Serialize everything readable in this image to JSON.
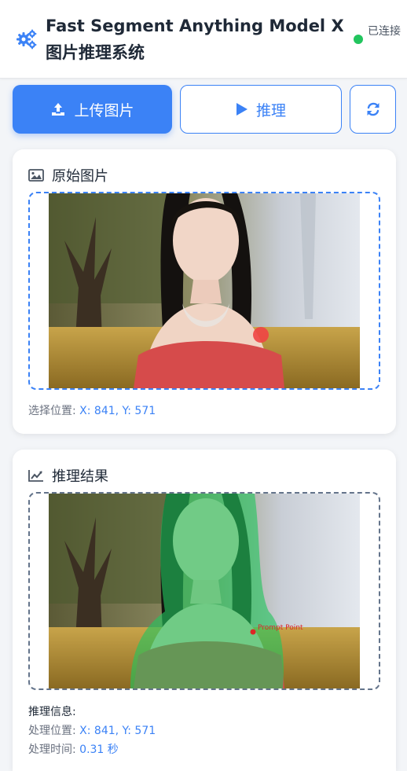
{
  "header": {
    "title": "Fast Segment Anything Model X 图片推理系统",
    "status_text": "已连接",
    "status_color": "#22c55e",
    "logo_icon": "gears-icon"
  },
  "toolbar": {
    "upload_label": "上传图片",
    "upload_icon": "upload-icon",
    "infer_label": "推理",
    "infer_icon": "play-icon",
    "refresh_icon": "refresh-icon",
    "accent_color": "#3b82f6"
  },
  "original": {
    "title": "原始图片",
    "title_icon": "image-icon",
    "position_label": "选择位置:",
    "position_value": "X: 841, Y: 571"
  },
  "result": {
    "title": "推理结果",
    "title_icon": "chart-line-icon",
    "overlay_label": "Prompt Point",
    "info_title": "推理信息:",
    "position_label": "处理位置:",
    "position_value": "X: 841, Y: 571",
    "time_label": "处理时间:",
    "time_value": "0.31 秒"
  }
}
